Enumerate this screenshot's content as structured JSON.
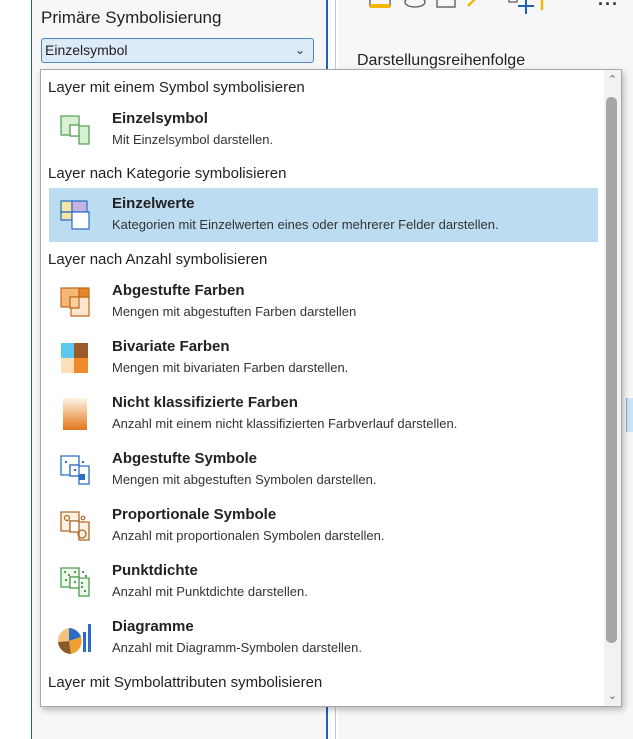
{
  "panel": {
    "heading": "Primäre Symbolisierung",
    "selected_value": "Einzelsymbol"
  },
  "right_panel": {
    "heading": "Darstellungsreihenfolge"
  },
  "dropdown": {
    "groups": [
      {
        "title": "Layer mit einem Symbol symbolisieren",
        "items": [
          {
            "title": "Einzelsymbol",
            "desc": "Mit Einzelsymbol darstellen.",
            "icon": "single-symbol-icon"
          }
        ]
      },
      {
        "title": "Layer nach Kategorie symbolisieren",
        "items": [
          {
            "title": "Einzelwerte",
            "desc": "Kategorien mit Einzelwerten eines oder mehrerer Felder darstellen.",
            "icon": "unique-values-icon"
          }
        ]
      },
      {
        "title": "Layer nach Anzahl symbolisieren",
        "items": [
          {
            "title": "Abgestufte Farben",
            "desc": "Mengen mit abgestuften Farben darstellen",
            "icon": "graduated-colors-icon"
          },
          {
            "title": "Bivariate Farben",
            "desc": "Mengen mit bivariaten Farben darstellen.",
            "icon": "bivariate-colors-icon"
          },
          {
            "title": "Nicht klassifizierte Farben",
            "desc": "Anzahl mit einem nicht klassifizierten Farbverlauf darstellen.",
            "icon": "unclassed-colors-icon"
          },
          {
            "title": "Abgestufte Symbole",
            "desc": "Mengen mit abgestuften Symbolen darstellen.",
            "icon": "graduated-symbols-icon"
          },
          {
            "title": "Proportionale Symbole",
            "desc": "Anzahl mit proportionalen Symbolen darstellen.",
            "icon": "proportional-symbols-icon"
          },
          {
            "title": "Punktdichte",
            "desc": "Anzahl mit Punktdichte darstellen.",
            "icon": "dot-density-icon"
          },
          {
            "title": "Diagramme",
            "desc": "Anzahl mit Diagramm-Symbolen darstellen.",
            "icon": "charts-icon"
          }
        ]
      },
      {
        "title": "Layer mit Symbolattributen symbolisieren",
        "items": []
      }
    ],
    "selected_item": "Einzelwerte"
  },
  "colors": {
    "accent": "#1e62b5",
    "selection": "#bcdcf1",
    "select_bg": "#ddeaf7"
  }
}
